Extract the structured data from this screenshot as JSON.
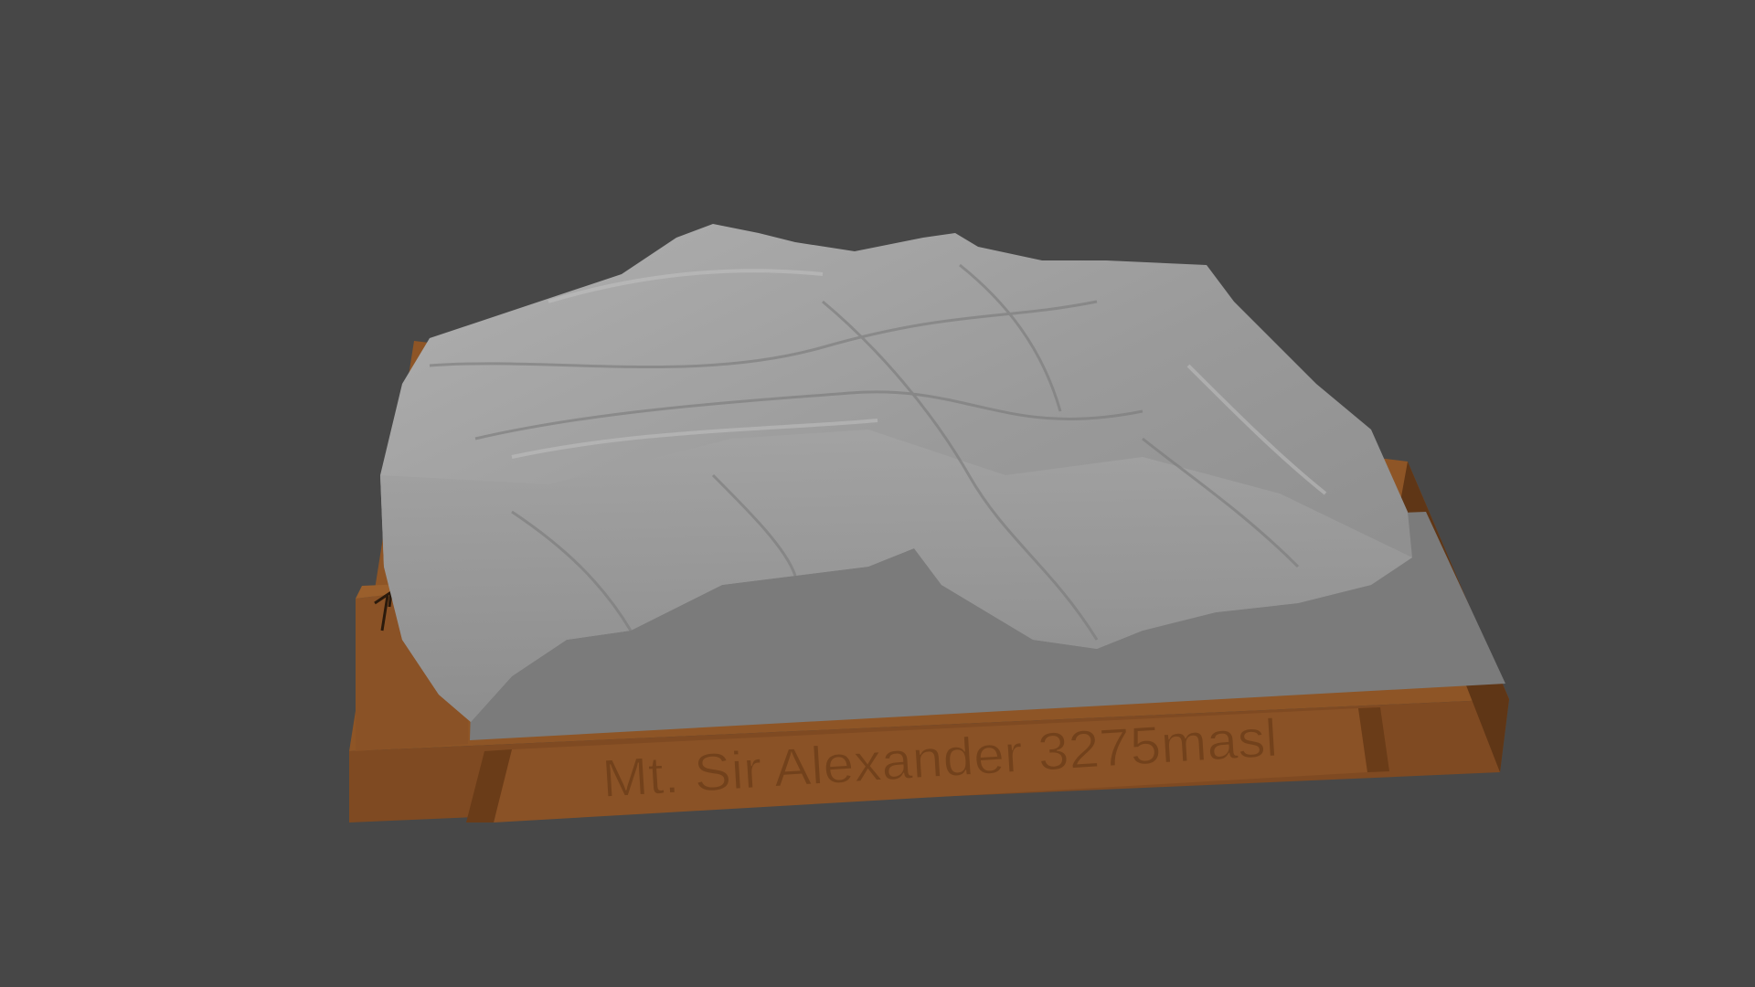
{
  "scene": {
    "subject": "3D terrain model on a base",
    "base_label": "Mt. Sir Alexander 3275masl"
  },
  "colors": {
    "background": "#474747",
    "base_top": "#8e5526",
    "base_front": "#7a4620",
    "base_side": "#5f3616",
    "terrain": "#9c9c9c",
    "terrain_shadow": "#6f6f6f",
    "flat_ground": "#7d7d7d"
  }
}
